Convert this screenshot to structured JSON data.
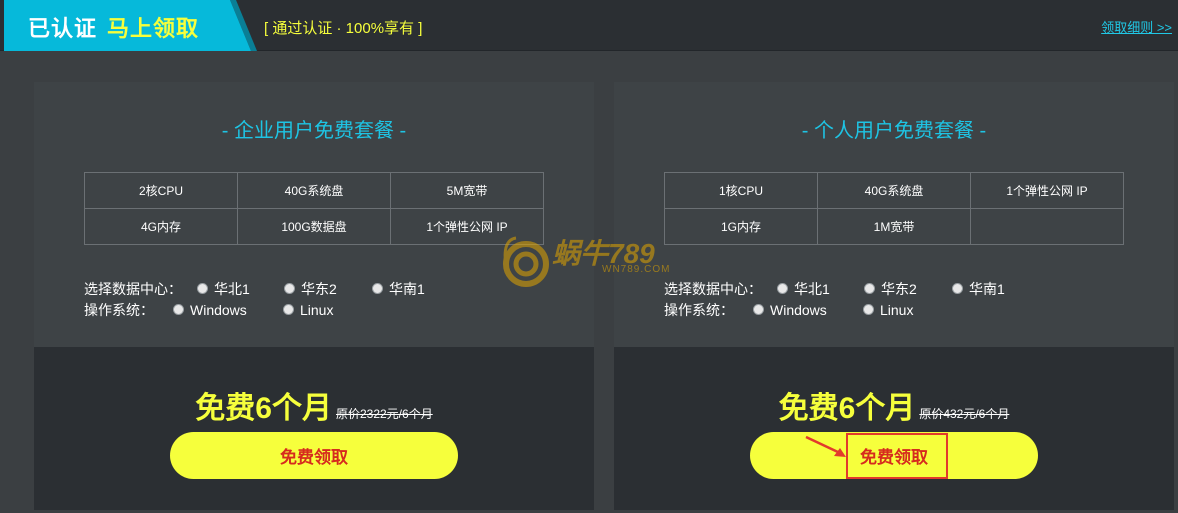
{
  "header": {
    "verified": "已认证",
    "claim_now": "马上领取",
    "subtitle": "[ 通过认证 · 100%享有 ]",
    "rules_link": "领取细则 >>"
  },
  "cards": [
    {
      "title": "- 企业用户免费套餐 -",
      "specs": [
        [
          "2核CPU",
          "40G系统盘",
          "5M宽带"
        ],
        [
          "4G内存",
          "100G数据盘",
          "1个弹性公网 IP"
        ]
      ],
      "datacenter_label": "选择数据中心：",
      "datacenters": [
        "华北1",
        "华东2",
        "华南1"
      ],
      "os_label": "操作系统：",
      "os": [
        "Windows",
        "Linux"
      ],
      "price": "免费6个月",
      "original_price": "原价2322元/6个月",
      "button": "免费领取"
    },
    {
      "title": "- 个人用户免费套餐 -",
      "specs": [
        [
          "1核CPU",
          "40G系统盘",
          "1个弹性公网 IP"
        ],
        [
          "1G内存",
          "1M宽带",
          ""
        ]
      ],
      "datacenter_label": "选择数据中心：",
      "datacenters": [
        "华北1",
        "华东2",
        "华南1"
      ],
      "os_label": "操作系统：",
      "os": [
        "Windows",
        "Linux"
      ],
      "price": "免费6个月",
      "original_price": "原价432元/6个月",
      "button": "免费领取"
    }
  ],
  "watermark": {
    "brand": "蜗牛789",
    "domain": "WN789.COM"
  },
  "colors": {
    "accent_cyan": "#06b9da",
    "accent_yellow": "#f6ff3c",
    "button_text_red": "#d62b1e",
    "highlight_red": "#e23a2c"
  }
}
